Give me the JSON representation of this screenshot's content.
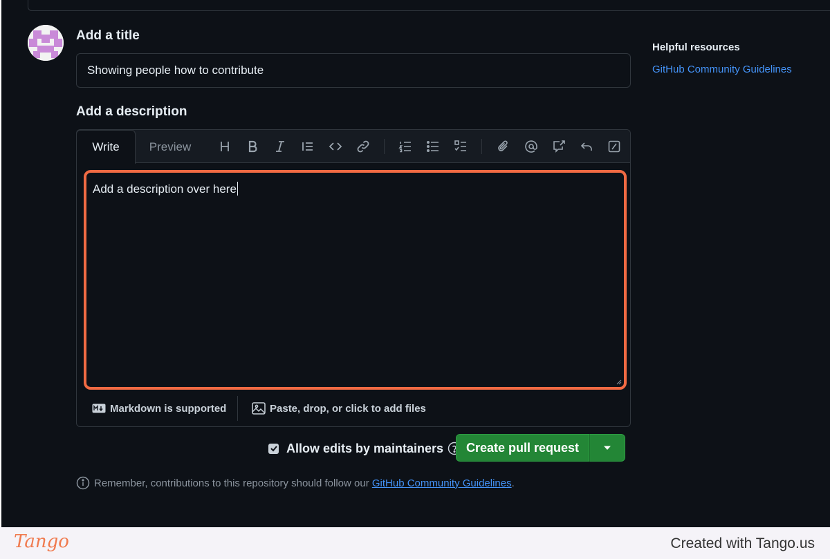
{
  "form": {
    "title_label": "Add a title",
    "title_value": "Showing people how to contribute",
    "description_label": "Add a description"
  },
  "editor": {
    "tabs": [
      {
        "label": "Write",
        "active": true
      },
      {
        "label": "Preview",
        "active": false
      }
    ],
    "toolbar_icons": [
      "heading-icon",
      "bold-icon",
      "italic-icon",
      "quote-icon",
      "code-icon",
      "link-icon",
      "numbered-list-icon",
      "unordered-list-icon",
      "task-list-icon",
      "attach-icon",
      "mention-icon",
      "reference-icon",
      "undo-icon",
      "slash-command-icon"
    ],
    "body_text": "Add a description over here",
    "markdown_note": "Markdown is supported",
    "attach_note": "Paste, drop, or click to add files"
  },
  "actions": {
    "allow_edits_label": "Allow edits by maintainers",
    "allow_edits_checked": true,
    "create_label": "Create pull request"
  },
  "reminder": {
    "prefix": "Remember, contributions to this repository should follow our",
    "link": "GitHub Community Guidelines",
    "suffix": "."
  },
  "sidebar": {
    "title": "Helpful resources",
    "link": "GitHub Community Guidelines"
  },
  "footer": {
    "logo": "Tango",
    "credit": "Created with Tango.us"
  },
  "colors": {
    "background": "#0d1117",
    "highlight": "#f06a43",
    "primary_button": "#238636",
    "link": "#4493f8"
  }
}
